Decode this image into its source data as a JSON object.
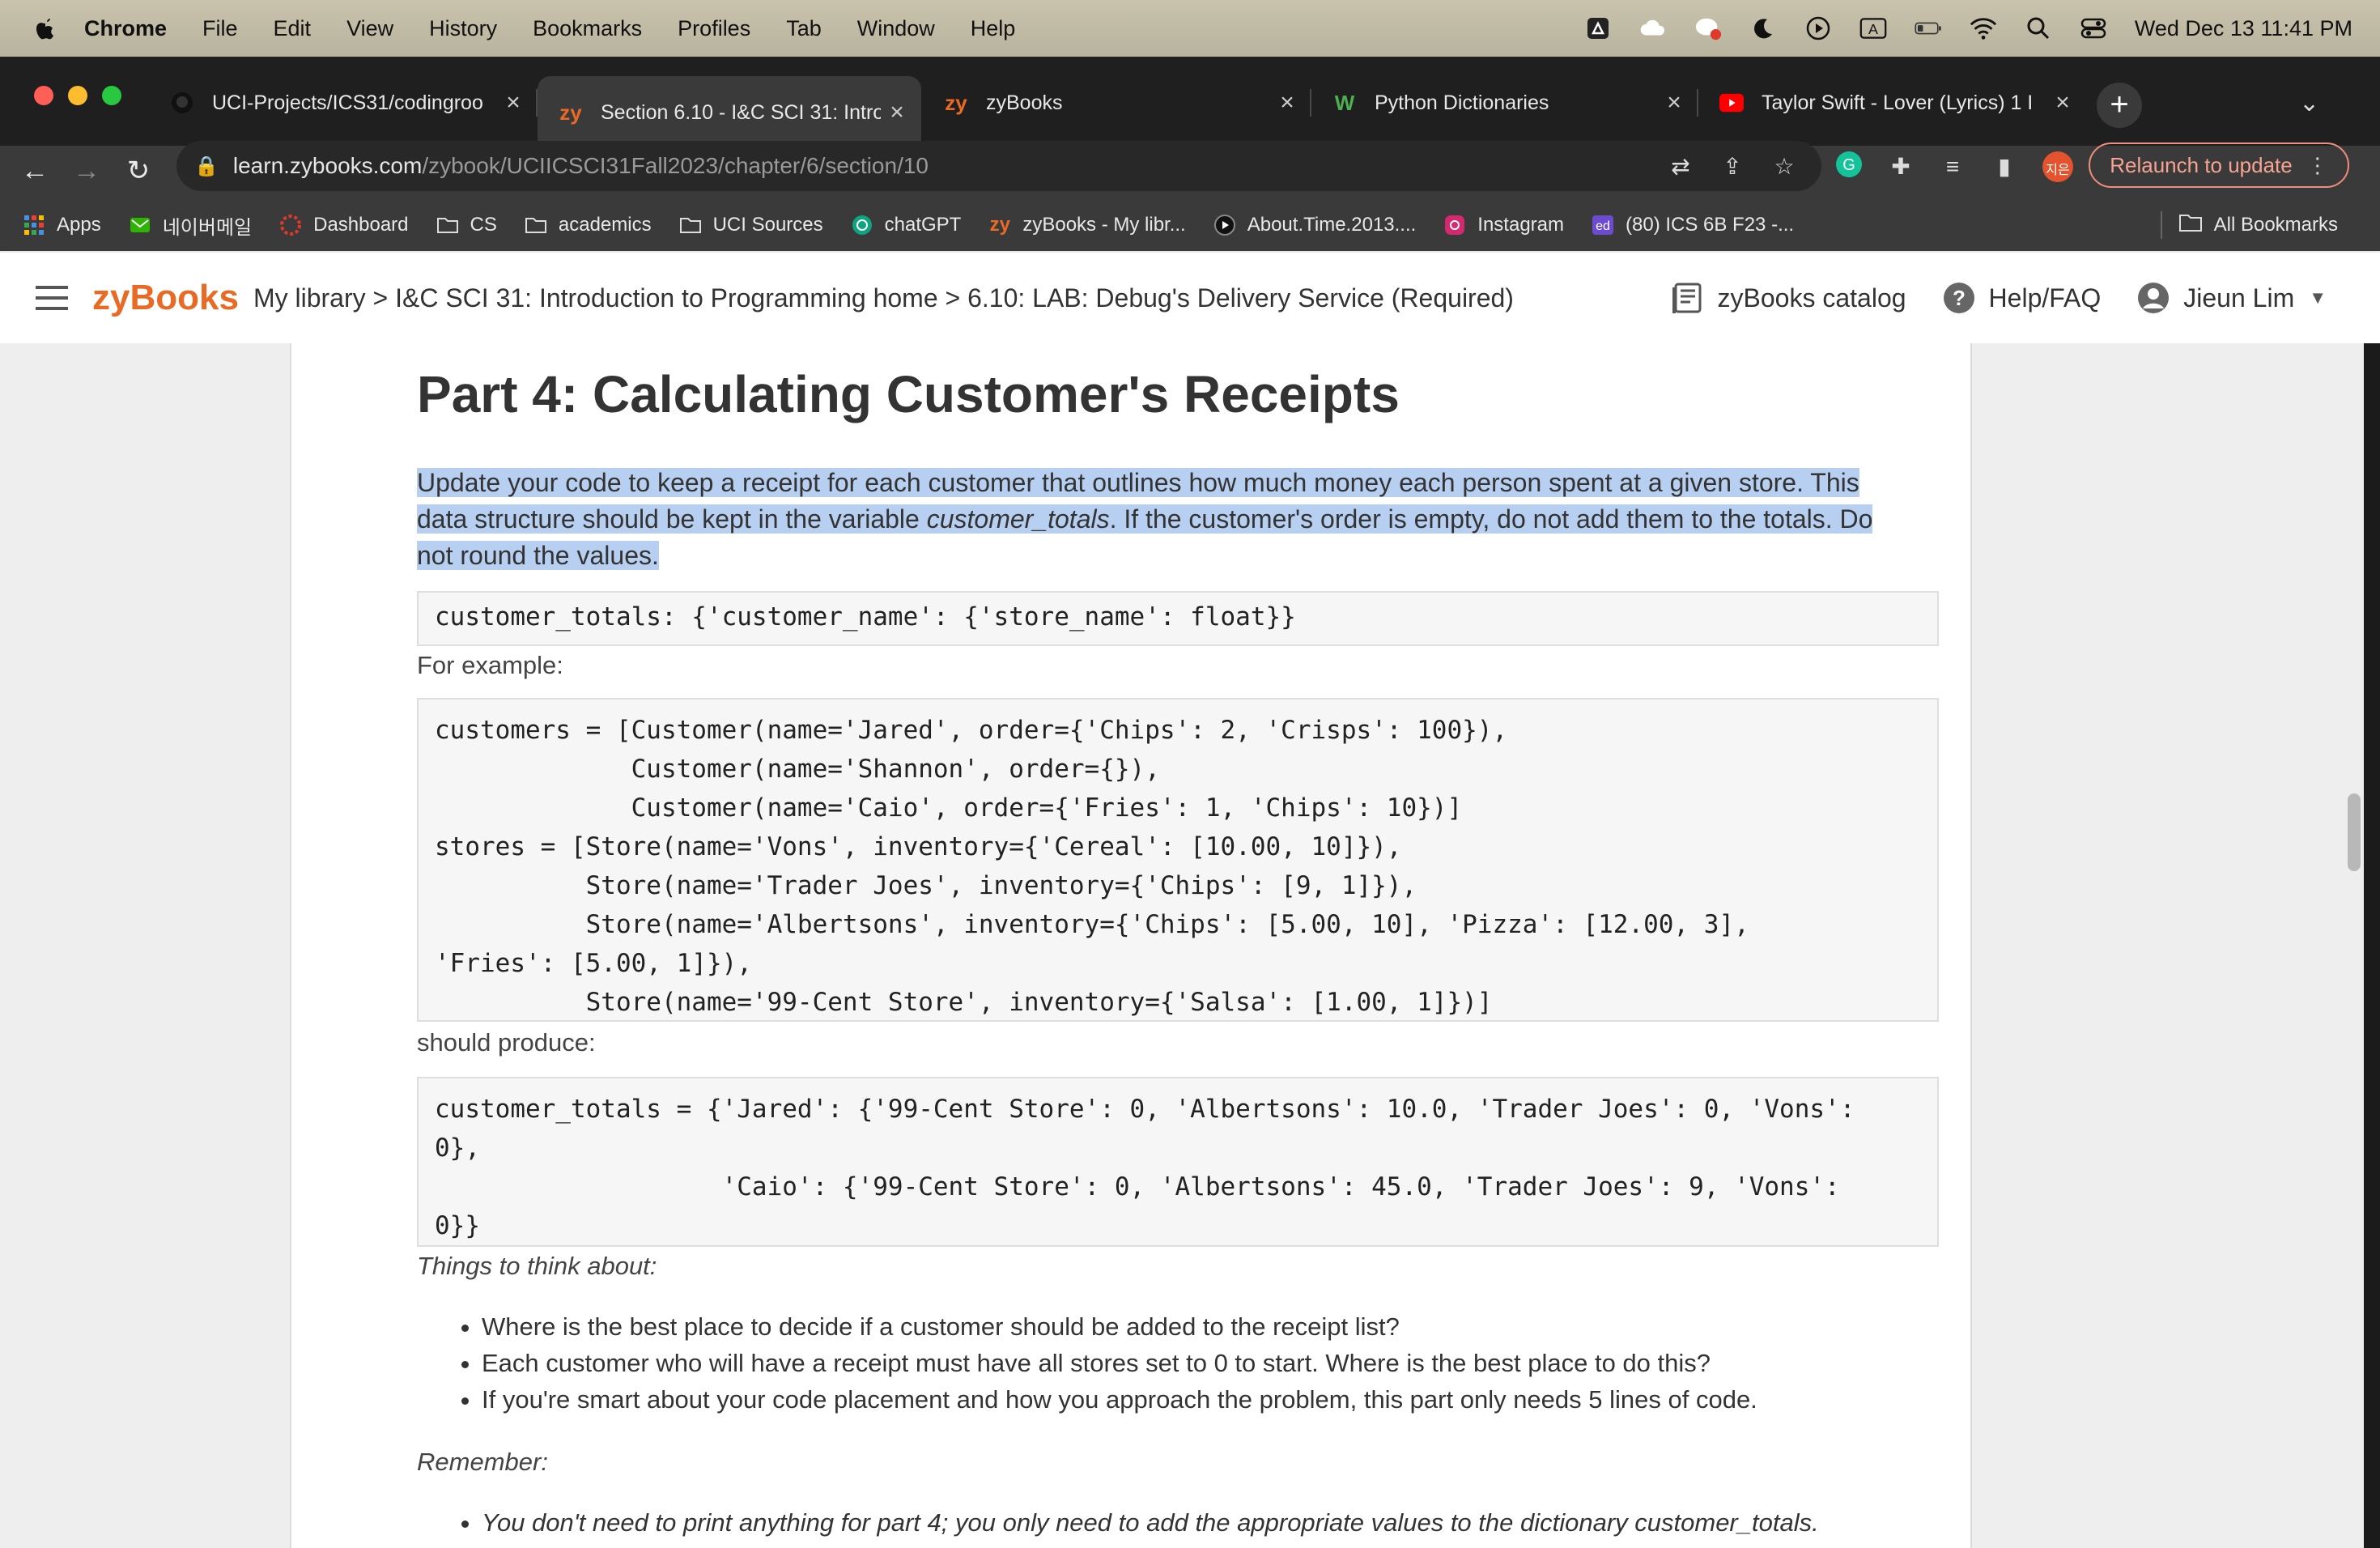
{
  "menubar": {
    "app": "Chrome",
    "items": [
      "File",
      "Edit",
      "View",
      "History",
      "Bookmarks",
      "Profiles",
      "Tab",
      "Window",
      "Help"
    ],
    "datetime": "Wed Dec 13  11:41 PM"
  },
  "tabs": [
    {
      "title": "UCI-Projects/ICS31/codingroo",
      "icon": "github-icon"
    },
    {
      "title": "Section 6.10 - I&C SCI 31: Intro",
      "icon": "zy-icon",
      "active": true
    },
    {
      "title": "zyBooks",
      "icon": "zy-icon"
    },
    {
      "title": "Python Dictionaries",
      "icon": "w3-icon"
    },
    {
      "title": "Taylor Swift - Lover (Lyrics) 1 I",
      "icon": "youtube-icon"
    }
  ],
  "address": {
    "host": "learn.zybooks.com",
    "path": "/zybook/UCIICSCI31Fall2023/chapter/6/section/10"
  },
  "relaunch_label": "Relaunch to update",
  "profile_initials": "지은",
  "bookmarks": [
    {
      "label": "Apps",
      "icon": "apps-grid-icon"
    },
    {
      "label": "네이버메일",
      "icon": "naver-mail-icon"
    },
    {
      "label": "Dashboard",
      "icon": "dashboard-icon"
    },
    {
      "label": "CS",
      "icon": "folder-icon"
    },
    {
      "label": "academics",
      "icon": "folder-icon"
    },
    {
      "label": "UCI Sources",
      "icon": "folder-icon"
    },
    {
      "label": "chatGPT",
      "icon": "chatgpt-icon"
    },
    {
      "label": "zyBooks - My libr...",
      "icon": "zy-icon"
    },
    {
      "label": "About.Time.2013....",
      "icon": "play-circle-icon"
    },
    {
      "label": "Instagram",
      "icon": "instagram-icon"
    },
    {
      "label": "(80) ICS 6B F23 -...",
      "icon": "ed-icon"
    }
  ],
  "all_bookmarks": "All Bookmarks",
  "zy": {
    "logo": "zyBooks",
    "breadcrumb": "My library > I&C SCI 31: Introduction to Programming home > 6.10: LAB: Debug's Delivery Service (Required)",
    "catalog": "zyBooks catalog",
    "help": "Help/FAQ",
    "user": "Jieun Lim"
  },
  "content": {
    "heading": "Part 4: Calculating Customer's Receipts",
    "para_a": "Update your code to keep a receipt for each customer that outlines how much money each person spent at a given store. This data structure should be kept in the variable ",
    "para_var": "customer_totals",
    "para_b": ". If the customer's order is empty, do not add them to the totals. Do not round the values.",
    "code_structure": "customer_totals: {'customer_name': {'store_name': float}}",
    "for_example": "For example:",
    "code_example": "customers = [Customer(name='Jared', order={'Chips': 2, 'Crisps': 100}),\n             Customer(name='Shannon', order={}),\n             Customer(name='Caio', order={'Fries': 1, 'Chips': 10})]\nstores = [Store(name='Vons', inventory={'Cereal': [10.00, 10]}),\n          Store(name='Trader Joes', inventory={'Chips': [9, 1]}),\n          Store(name='Albertsons', inventory={'Chips': [5.00, 10], 'Pizza': [12.00, 3],\n'Fries': [5.00, 1]}),\n          Store(name='99-Cent Store', inventory={'Salsa': [1.00, 1]})]",
    "should_produce": "should produce:",
    "code_result": "customer_totals = {'Jared': {'99-Cent Store': 0, 'Albertsons': 10.0, 'Trader Joes': 0, 'Vons':\n0},\n                   'Caio': {'99-Cent Store': 0, 'Albertsons': 45.0, 'Trader Joes': 9, 'Vons':\n0}}",
    "things_title": "Things to think about:",
    "things": [
      "Where is the best place to decide if a customer should be added to the receipt list?",
      "Each customer who will have a receipt must have all stores set to 0 to start. Where is the best place to do this?",
      "If you're smart about your code placement and how you approach the problem, this part only needs 5 lines of code."
    ],
    "remember_title": "Remember:",
    "remember": [
      "You don't need to print anything for part 4; you only need to add the appropriate values to the dictionary customer_totals."
    ]
  },
  "colors": {
    "zy_orange": "#e96a25",
    "highlight": "#b7cff0",
    "toolbar": "#3a3a3a",
    "tabstrip": "#1f1f1f"
  }
}
